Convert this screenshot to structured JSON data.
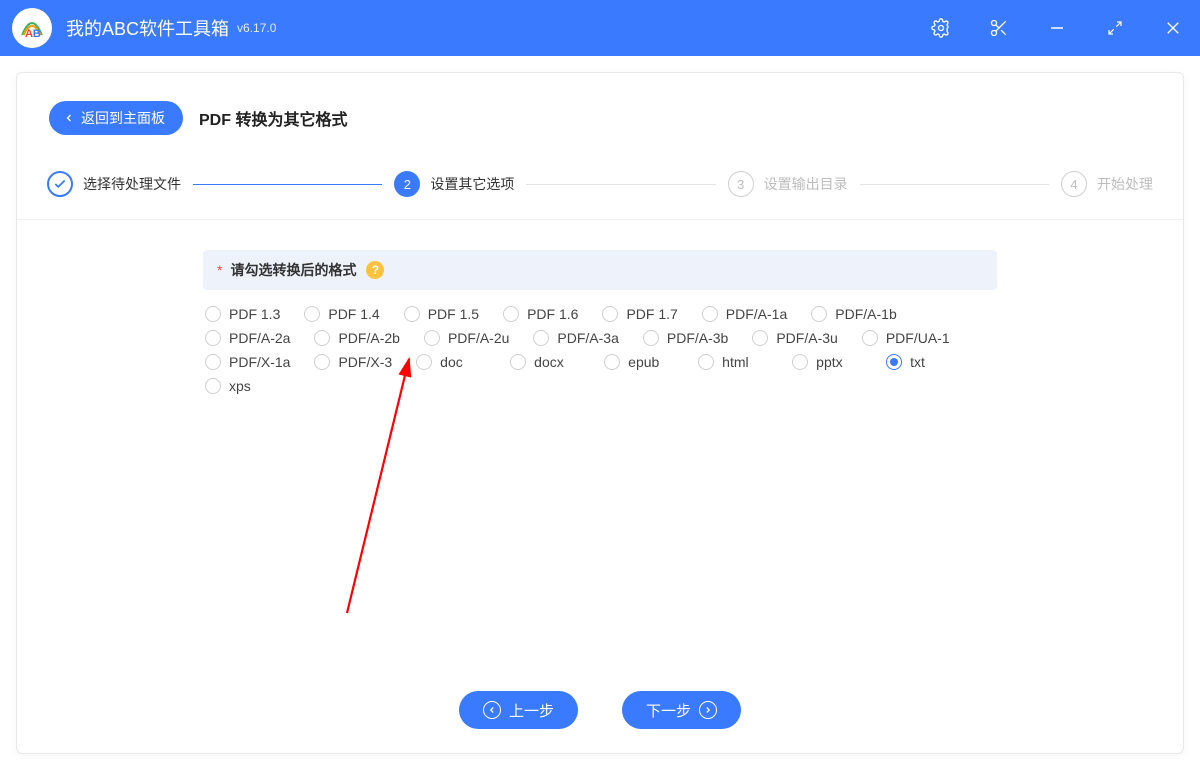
{
  "titlebar": {
    "app_name": "我的ABC软件工具箱",
    "version": "v6.17.0"
  },
  "header": {
    "back_label": "返回到主面板",
    "page_title": "PDF 转换为其它格式"
  },
  "steps": [
    {
      "label": "选择待处理文件",
      "state": "done"
    },
    {
      "label": "设置其它选项",
      "state": "current",
      "num": "2"
    },
    {
      "label": "设置输出目录",
      "state": "future",
      "num": "3"
    },
    {
      "label": "开始处理",
      "state": "future",
      "num": "4"
    }
  ],
  "section": {
    "asterisk": "*",
    "title": "请勾选转换后的格式",
    "help": "?"
  },
  "formats": [
    "PDF 1.3",
    "PDF 1.4",
    "PDF 1.5",
    "PDF 1.6",
    "PDF 1.7",
    "PDF/A-1a",
    "PDF/A-1b",
    "PDF/A-2a",
    "PDF/A-2b",
    "PDF/A-2u",
    "PDF/A-3a",
    "PDF/A-3b",
    "PDF/A-3u",
    "PDF/UA-1",
    "PDF/X-1a",
    "PDF/X-3",
    "doc",
    "docx",
    "epub",
    "html",
    "pptx",
    "txt",
    "xps"
  ],
  "selected_format": "txt",
  "footer": {
    "prev": "上一步",
    "next": "下一步"
  }
}
